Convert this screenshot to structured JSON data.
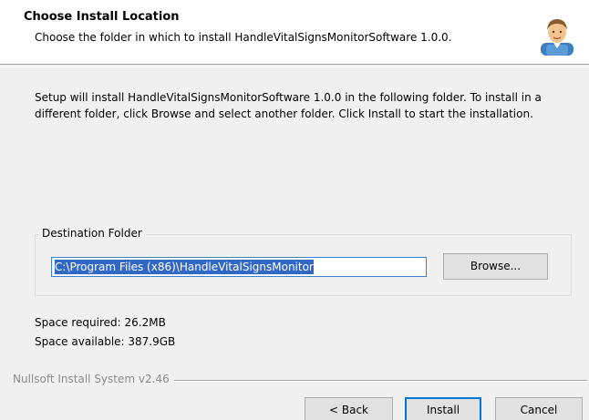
{
  "header": {
    "title": "Choose Install Location",
    "subtitle": "Choose the folder in which to install HandleVitalSignsMonitorSoftware 1.0.0.",
    "icon": "installer-user-icon"
  },
  "body": {
    "description": "Setup will install HandleVitalSignsMonitorSoftware 1.0.0 in the following folder. To install in a different folder, click Browse and select another folder. Click Install to start the installation."
  },
  "destination": {
    "group_label": "Destination Folder",
    "path_value": "C:\\Program Files (x86)\\HandleVitalSignsMonitor",
    "browse_label": "Browse..."
  },
  "space": {
    "required": "Space required: 26.2MB",
    "available": "Space available: 387.9GB"
  },
  "footer": {
    "branding": "Nullsoft Install System v2.46",
    "back_label": "< Back",
    "install_label": "Install",
    "cancel_label": "Cancel"
  },
  "colors": {
    "selection": "#3168c6",
    "focus_border": "#0078d7",
    "dialog_bg": "#f0f0f0"
  }
}
